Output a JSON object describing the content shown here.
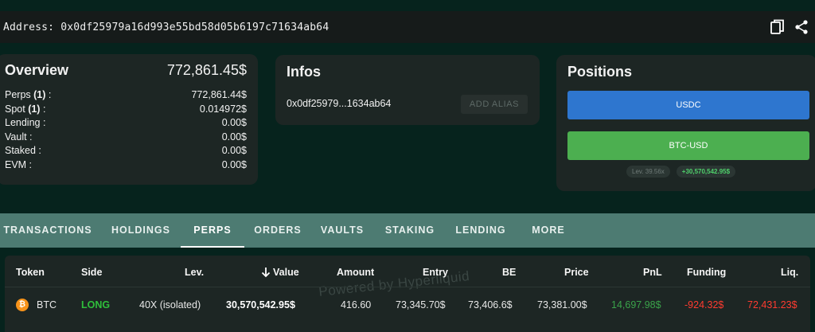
{
  "address_bar": {
    "label": "Address: 0x0df25979a16d993e55bd58d05b6197c71634ab64"
  },
  "overview": {
    "title": "Overview",
    "total": "772,861.45$",
    "rows": [
      {
        "label_pre": "Perps ",
        "label_bold": "(1)",
        "label_post": " :",
        "value": "772,861.44$"
      },
      {
        "label_pre": "Spot ",
        "label_bold": "(1)",
        "label_post": " :",
        "value": "0.014972$"
      },
      {
        "label_pre": "Lending :",
        "label_bold": "",
        "label_post": "",
        "value": "0.00$"
      },
      {
        "label_pre": "Vault :",
        "label_bold": "",
        "label_post": "",
        "value": "0.00$"
      },
      {
        "label_pre": "Staked :",
        "label_bold": "",
        "label_post": "",
        "value": "0.00$"
      },
      {
        "label_pre": "EVM :",
        "label_bold": "",
        "label_post": "",
        "value": "0.00$"
      }
    ]
  },
  "infos": {
    "title": "Infos",
    "short_address": "0x0df25979...1634ab64",
    "alias_button": "ADD ALIAS"
  },
  "positions": {
    "title": "Positions",
    "usdc_label": "USDC",
    "btc_label": "BTC-USD",
    "lev_chip": "Lev. 39.56x",
    "pnl_chip": "+30,570,542.95$"
  },
  "tabs": [
    "TRANSACTIONS",
    "HOLDINGS",
    "PERPS",
    "ORDERS",
    "VAULTS",
    "STAKING",
    "LENDING",
    "MORE"
  ],
  "active_tab": "PERPS",
  "table": {
    "headers": {
      "token": "Token",
      "side": "Side",
      "lev": "Lev.",
      "value": "Value",
      "amount": "Amount",
      "entry": "Entry",
      "be": "BE",
      "price": "Price",
      "pnl": "PnL",
      "funding": "Funding",
      "liq": "Liq."
    },
    "watermark": "Powered by Hyperliquid",
    "rows": [
      {
        "token_icon": "bitcoin-icon",
        "token": "BTC",
        "side": "LONG",
        "lev": "40X (isolated)",
        "value": "30,570,542.95$",
        "amount": "416.60",
        "entry": "73,345.70$",
        "be": "73,406.6$",
        "price": "73,381.00$",
        "pnl": "14,697.98$",
        "funding": "-924.32$",
        "liq": "72,431.23$"
      }
    ]
  },
  "colors": {
    "background": "#06231d",
    "card": "#1d2624",
    "tabs_bar": "#4d7b72",
    "usdc": "#2e76cf",
    "btc": "#4caf50",
    "long": "#2fbf3b",
    "pnl_positive": "#3aa34a",
    "negative": "#ff3b30"
  },
  "icons": {
    "copy": "copy-icon",
    "share": "share-icon",
    "sort": "arrow-down-icon"
  }
}
